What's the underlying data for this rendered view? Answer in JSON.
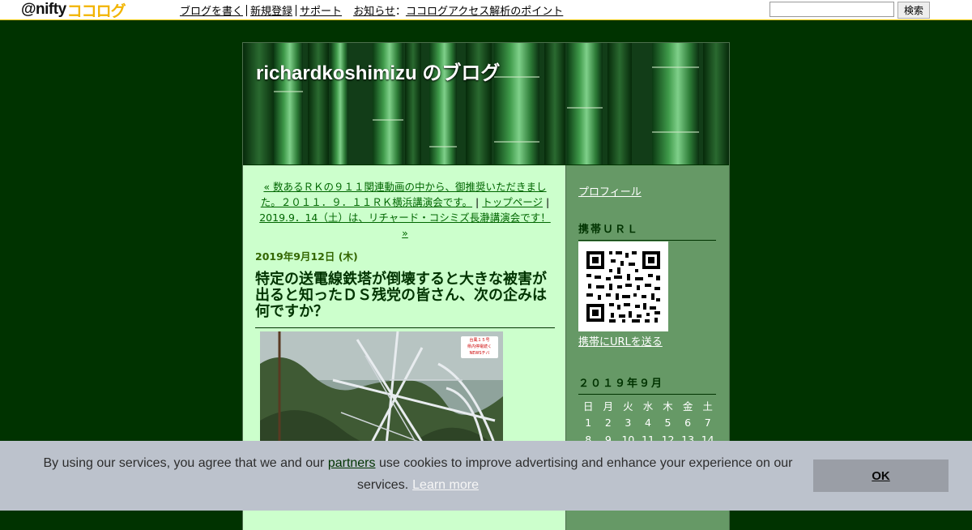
{
  "topbar": {
    "logo_main": "@nifty",
    "logo_accent": "ココログ",
    "nav": [
      "ブログを書く",
      "新規登録",
      "サポート"
    ],
    "notice_label": "お知らせ",
    "notice_sep": "：",
    "notice_link": "ココログアクセス解析のポイント",
    "search_value": "",
    "search_button": "検索"
  },
  "blog": {
    "title": "richardkoshimizu のブログ"
  },
  "post_nav": {
    "prev_link": "« 数あるＲＫの９１１関連動画の中から、御推奨いただきました。２０１１．９．１１ＲＫ横浜講演会です。",
    "divider": "|",
    "top_link": "トップページ",
    "next_link": "2019.9．14（土）は、リチャード・コシミズ長瀞講演会です！ »"
  },
  "post": {
    "date": "2019年9月12日 (木)",
    "title": "特定の送電線鉄塔が倒壊すると大きな被害が出ると知ったＤＳ残党の皆さん、次の企みは何ですか？",
    "image_badge_1": "台風１５号",
    "image_badge_2": "県内停電続く",
    "image_badge_3": "NEWSチバ"
  },
  "sidebar": {
    "profile_link": "プロフィール",
    "mobile_heading": "携帯ＵＲＬ",
    "send_link": "携帯にURLを送る",
    "calendar_heading": "２０１９年９月",
    "weekdays": [
      "日",
      "月",
      "火",
      "水",
      "木",
      "金",
      "土"
    ],
    "week1": [
      "1",
      "2",
      "3",
      "4",
      "5",
      "6",
      "7"
    ],
    "week2": [
      "8",
      "9",
      "10",
      "11",
      "12",
      "13",
      "14"
    ]
  },
  "cookie": {
    "text_before": "By using our services, you agree that we and our ",
    "partners_link": "partners",
    "text_after": " use cookies to improve advertising and enhance your experience on our services.",
    "learn_more": "Learn more",
    "ok_button": "OK"
  },
  "colors": {
    "page_bg": "#003300",
    "main_bg": "#ccffcc",
    "sidebar_bg": "#669966",
    "link_green": "#006600",
    "cookie_bg": "#bcc2cc"
  }
}
